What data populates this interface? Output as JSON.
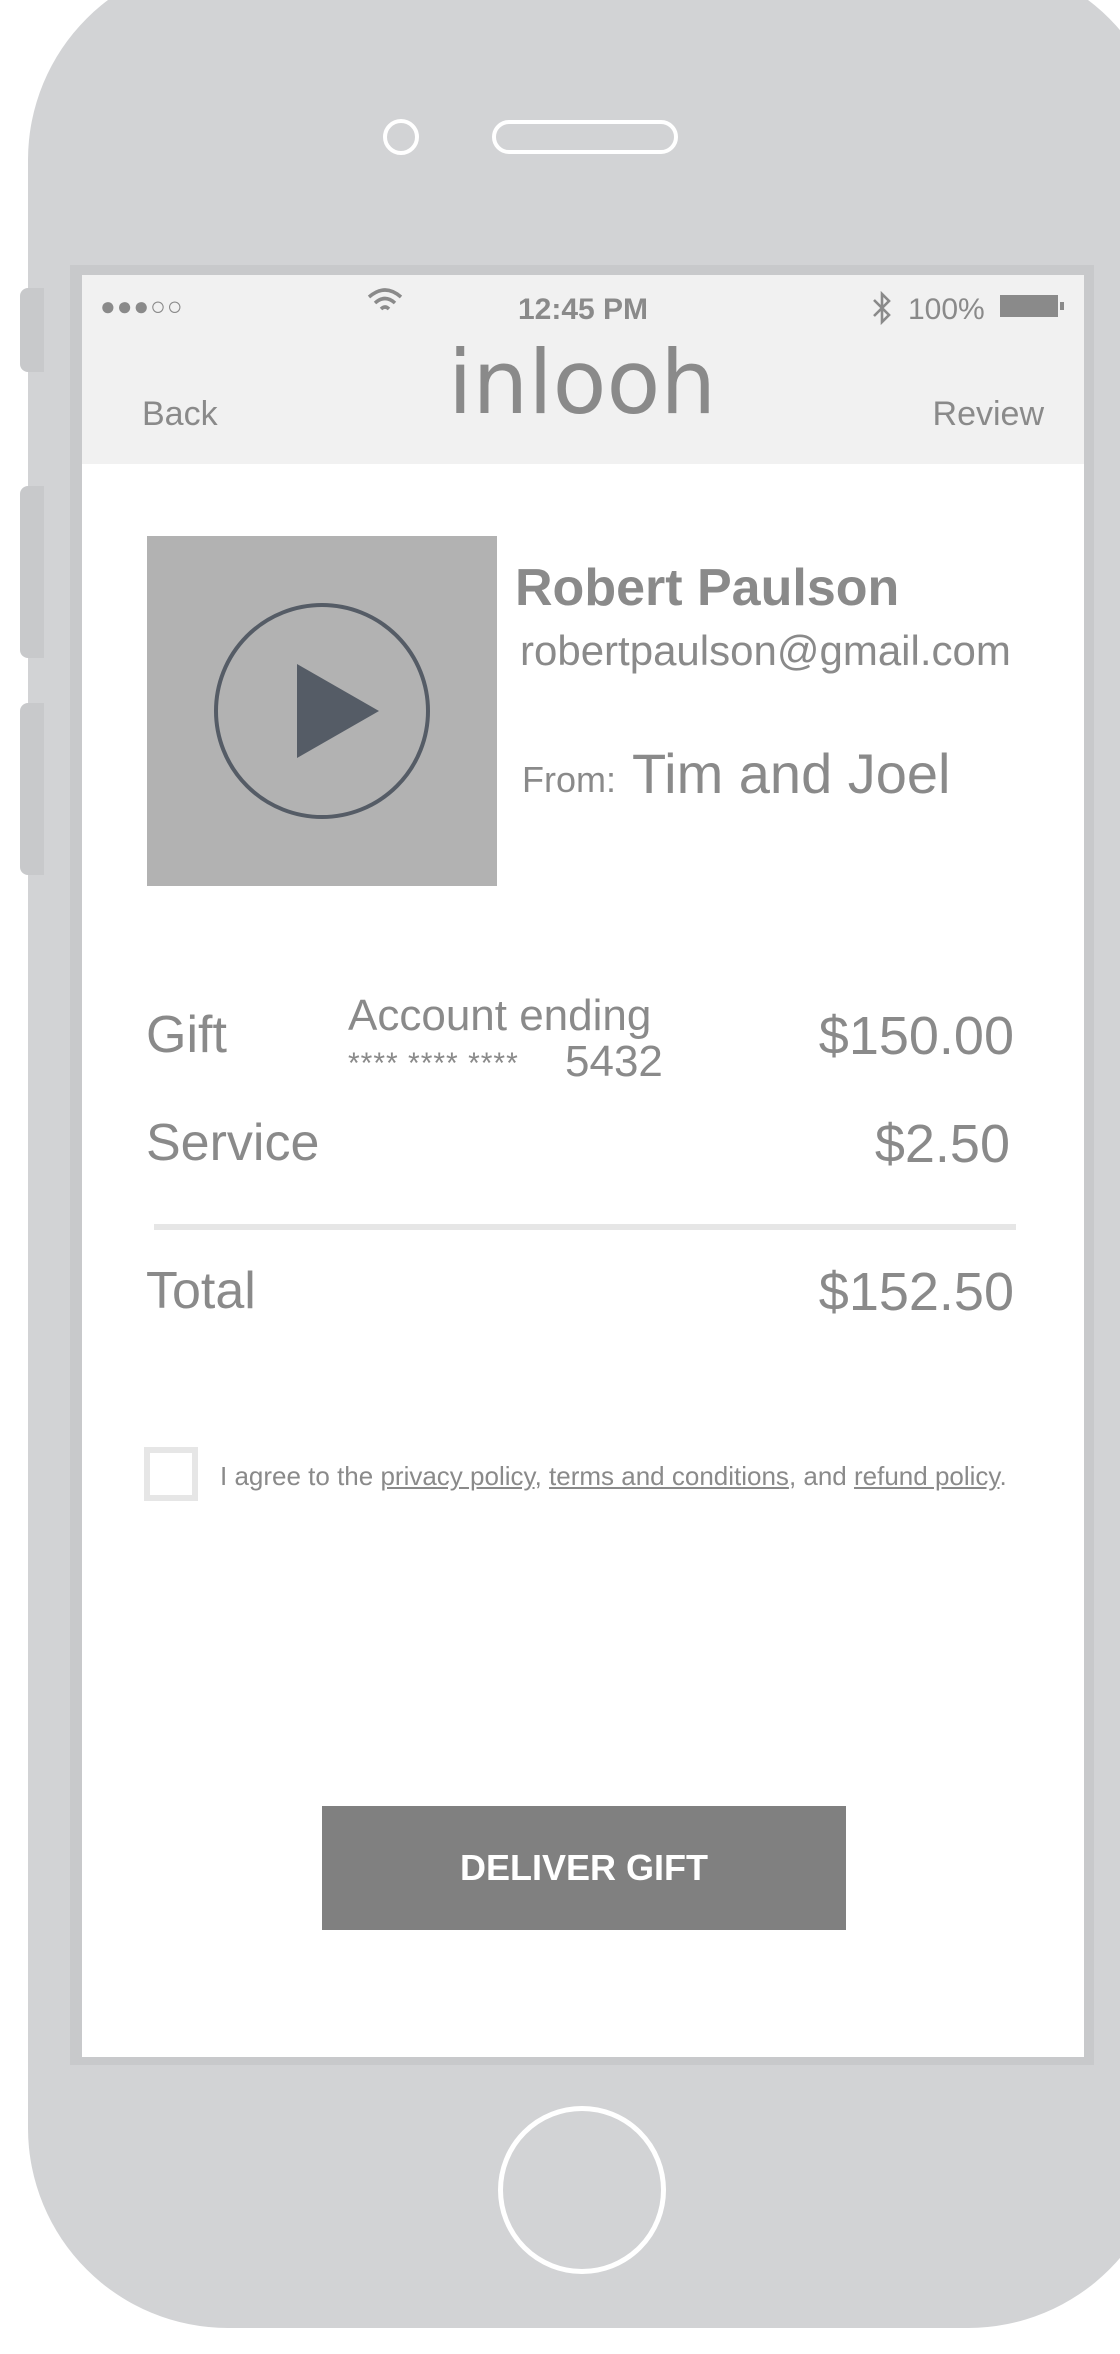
{
  "status_bar": {
    "signal": "●●●○○",
    "time": "12:45 PM",
    "battery_pct": "100%"
  },
  "header": {
    "back_label": "Back",
    "logo_text": "inlooh",
    "review_label": "Review"
  },
  "recipient": {
    "name": "Robert Paulson",
    "email": "robertpaulson@gmail.com",
    "from_label": "From:",
    "from_value": "Tim and Joel"
  },
  "summary": {
    "gift_label": "Gift",
    "account_title": "Account ending",
    "account_mask": "**** **** ****",
    "account_last4": "5432",
    "gift_amount": "$150.00",
    "service_label": "Service",
    "service_amount": "$2.50",
    "total_label": "Total",
    "total_amount": "$152.50"
  },
  "agreement": {
    "prefix": "I agree to the ",
    "privacy_link": "privacy policy",
    "sep1": ", ",
    "terms_link": "terms and conditions",
    "sep2": ", and ",
    "refund_link": "refund policy",
    "suffix": "."
  },
  "cta": {
    "label": "DELIVER GIFT"
  },
  "colors": {
    "phone_body": "#d2d3d5",
    "header_bg": "#f1f1f1",
    "text": "#8a8a8a",
    "button_bg": "#808080",
    "thumbnail_bg": "#b2b2b2",
    "play_icon": "#555c66"
  },
  "icons": [
    "signal-dots-icon",
    "wifi-icon",
    "bluetooth-icon",
    "battery-icon",
    "play-icon",
    "checkbox-icon"
  ]
}
